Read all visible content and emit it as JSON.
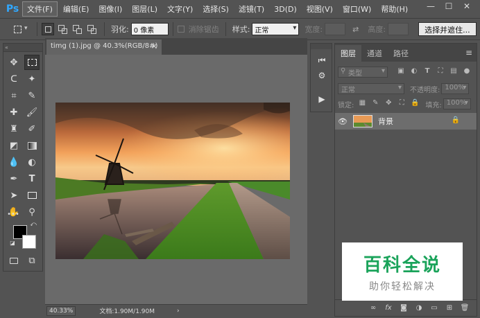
{
  "app": {
    "logo": "Ps"
  },
  "menu": [
    "文件(F)",
    "编辑(E)",
    "图像(I)",
    "图层(L)",
    "文字(Y)",
    "选择(S)",
    "滤镜(T)",
    "3D(D)",
    "视图(V)",
    "窗口(W)",
    "帮助(H)"
  ],
  "window_controls": {
    "minimize": "—",
    "maximize": "☐",
    "close": "✕"
  },
  "options": {
    "feather_label": "羽化:",
    "feather_value": "0 像素",
    "antialias_label": "消除锯齿",
    "style_label": "样式:",
    "style_value": "正常",
    "width_label": "宽度:",
    "height_label": "高度:",
    "select_mask_button": "选择并遮住..."
  },
  "document": {
    "tab_title": "timg (1).jpg @ 40.3%(RGB/8#)",
    "close": "×",
    "zoom": "40.33%",
    "doc_info": "文档:1.90M/1.90M",
    "status_arrow": "›"
  },
  "layers_panel": {
    "tabs": [
      "图层",
      "通道",
      "路径"
    ],
    "menu_icon": "≡",
    "filter_kind": "类型",
    "blend_mode": "正常",
    "opacity_label": "不透明度:",
    "opacity_value": "100%",
    "lock_label": "锁定:",
    "fill_label": "填充:",
    "fill_value": "100%",
    "layers": [
      {
        "name": "背景",
        "visible": true,
        "locked": true
      }
    ],
    "footer_icons": [
      "link-icon",
      "fx-icon",
      "mask-icon",
      "adjustment-icon",
      "group-icon",
      "new-layer-icon",
      "trash-icon"
    ]
  },
  "footer_labels": {
    "link": "∞",
    "fx": "fx"
  },
  "watermark": {
    "title": "百科全说",
    "subtitle": "助你轻松解决"
  },
  "colors": {
    "foreground": "#000000",
    "background": "#ffffff",
    "ps_blue": "#31a8ff",
    "watermark_green": "#1aa35a"
  }
}
